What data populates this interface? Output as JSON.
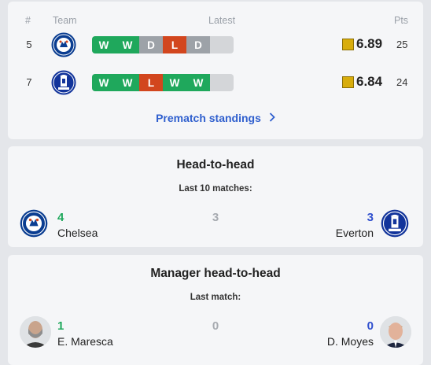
{
  "standings": {
    "headers": {
      "pos": "#",
      "team": "Team",
      "latest": "Latest",
      "pts": "Pts"
    },
    "rows": [
      {
        "pos": "5",
        "team": "Chelsea",
        "crest_icon": "chelsea-crest-icon",
        "form": [
          "W",
          "W",
          "D",
          "L",
          "D"
        ],
        "rating": "6.89",
        "pts": "25"
      },
      {
        "pos": "7",
        "team": "Everton",
        "crest_icon": "everton-crest-icon",
        "form": [
          "W",
          "W",
          "L",
          "W",
          "W"
        ],
        "rating": "6.84",
        "pts": "24"
      }
    ],
    "link_label": "Prematch standings",
    "link_icon": "chevron-right-icon"
  },
  "h2h": {
    "title": "Head-to-head",
    "subtitle": "Last 10 matches:",
    "home": {
      "name": "Chelsea",
      "wins": "4"
    },
    "draws": "3",
    "away": {
      "name": "Everton",
      "wins": "3"
    }
  },
  "manager_h2h": {
    "title": "Manager head-to-head",
    "subtitle": "Last match:",
    "home": {
      "name": "E. Maresca",
      "wins": "1"
    },
    "draws": "0",
    "away": {
      "name": "D. Moyes",
      "wins": "0"
    }
  },
  "colors": {
    "win": "#1fa85c",
    "draw": "#9da2a8",
    "loss": "#d2461e",
    "rating_badge": "#d8ad0c",
    "link": "#2f5fce",
    "away_count": "#2f4fce"
  }
}
